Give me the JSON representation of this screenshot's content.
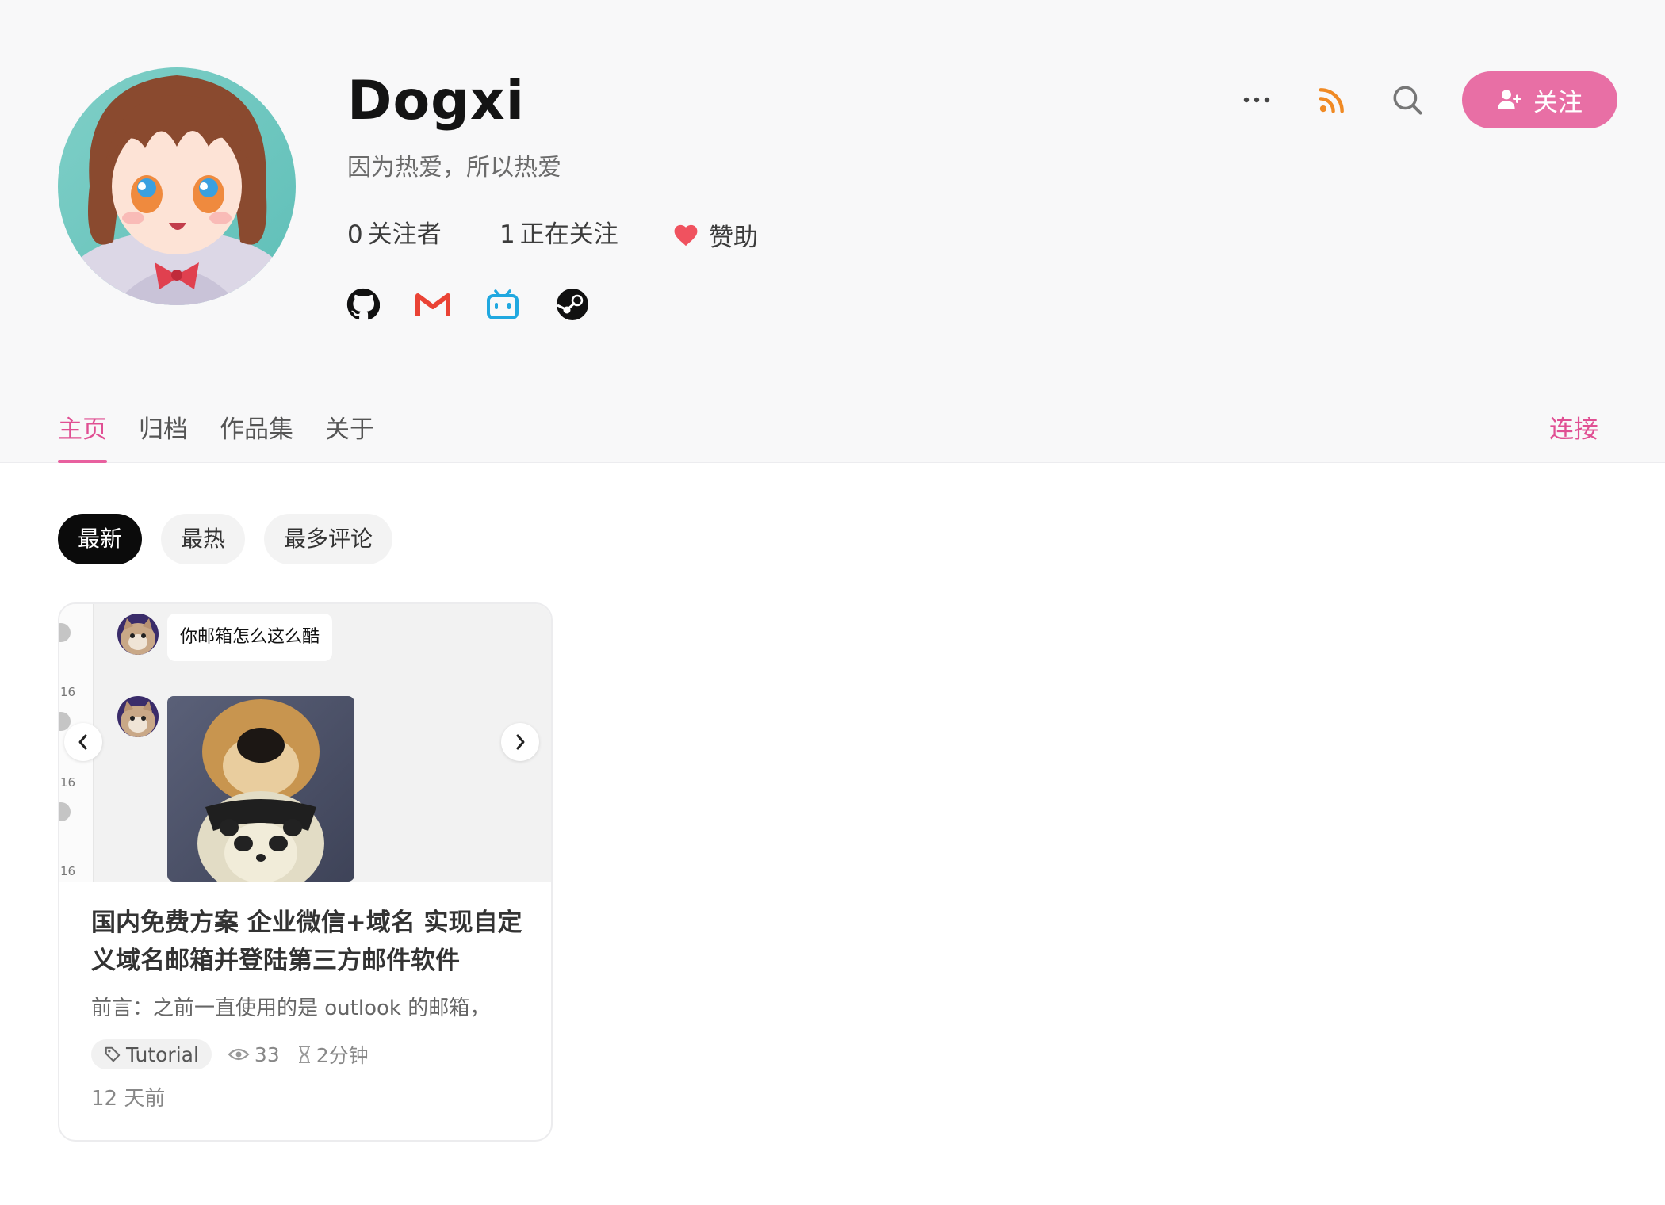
{
  "profile": {
    "name": "Dogxi",
    "bio": "因为热爱，所以热爱",
    "followers_count": "0",
    "followers_label": "关注者",
    "following_count": "1",
    "following_label": "正在关注",
    "sponsor_label": "赞助"
  },
  "socials": [
    "github-icon",
    "gmail-icon",
    "bilibili-icon",
    "steam-icon"
  ],
  "actions": {
    "more_icon": "ellipsis-icon",
    "rss_icon": "rss-icon",
    "search_icon": "search-icon",
    "follow_label": "关注"
  },
  "tabs": [
    {
      "label": "主页",
      "active": true
    },
    {
      "label": "归档",
      "active": false
    },
    {
      "label": "作品集",
      "active": false
    },
    {
      "label": "关于",
      "active": false
    }
  ],
  "connect_label": "连接",
  "filters": [
    {
      "label": "最新",
      "active": true
    },
    {
      "label": "最热",
      "active": false
    },
    {
      "label": "最多评论",
      "active": false
    }
  ],
  "post": {
    "cover": {
      "chat_message": "你邮箱怎么这么酷",
      "strip_numbers": [
        "16",
        "16",
        "16"
      ]
    },
    "title": "国内免费方案 企业微信+域名 实现自定义域名邮箱并登陆第三方邮件软件",
    "excerpt": "前言：之前一直使用的是 outlook 的邮箱，",
    "tag": "Tutorial",
    "views": "33",
    "read_time": "2分钟",
    "date": "12 天前"
  },
  "colors": {
    "accent": "#e86fa5",
    "accent_text": "#e04f93",
    "rss": "#f08a24",
    "bilibili": "#20a8e0",
    "gmail": "#ea4335",
    "heart": "#f0525f"
  }
}
